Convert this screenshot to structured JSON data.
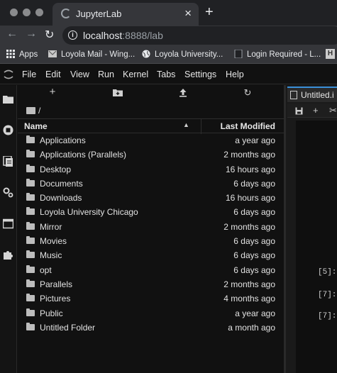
{
  "browser": {
    "tab_title": "JupyterLab",
    "tab_close": "×",
    "new_tab": "+",
    "url_host": "localhost",
    "url_rest": ":8888/lab",
    "nav": {
      "back": "←",
      "forward": "→",
      "reload": "↻"
    },
    "bookmarks": [
      {
        "label": "Apps",
        "icon": "apps-grid-icon"
      },
      {
        "label": "Loyola Mail - Wing...",
        "icon": "mail-icon"
      },
      {
        "label": "Loyola University...",
        "icon": "globe-icon"
      },
      {
        "label": "Login Required - L...",
        "icon": "page-icon"
      }
    ]
  },
  "menubar": {
    "items": [
      "File",
      "Edit",
      "View",
      "Run",
      "Kernel",
      "Tabs",
      "Settings",
      "Help"
    ]
  },
  "filebrowser": {
    "toolbar": {
      "new_launcher": "+",
      "new_folder": "new-folder-icon",
      "upload": "upload-icon",
      "refresh": "↻"
    },
    "breadcrumb": "/",
    "header": {
      "name": "Name",
      "modified": "Last Modified",
      "sort": "▲"
    },
    "rows": [
      {
        "name": "Applications",
        "modified": "a year ago"
      },
      {
        "name": "Applications (Parallels)",
        "modified": "2 months ago"
      },
      {
        "name": "Desktop",
        "modified": "16 hours ago"
      },
      {
        "name": "Documents",
        "modified": "6 days ago"
      },
      {
        "name": "Downloads",
        "modified": "16 hours ago"
      },
      {
        "name": "Loyola University Chicago",
        "modified": "6 days ago"
      },
      {
        "name": "Mirror",
        "modified": "2 months ago"
      },
      {
        "name": "Movies",
        "modified": "6 days ago"
      },
      {
        "name": "Music",
        "modified": "6 days ago"
      },
      {
        "name": "opt",
        "modified": "6 days ago"
      },
      {
        "name": "Parallels",
        "modified": "2 months ago"
      },
      {
        "name": "Pictures",
        "modified": "4 months ago"
      },
      {
        "name": "Public",
        "modified": "a year ago"
      },
      {
        "name": "Untitled Folder",
        "modified": "a month ago"
      }
    ]
  },
  "notebook": {
    "tab_title": "Untitled.i",
    "toolbar": {
      "save": "save-icon",
      "insert": "+",
      "cut": "✂"
    },
    "prompts": [
      "[5]:",
      "[7]:",
      "[7]:"
    ]
  },
  "colors": {
    "accent": "#3a8fd8",
    "background": "#111111",
    "chrome": "#35363a"
  }
}
